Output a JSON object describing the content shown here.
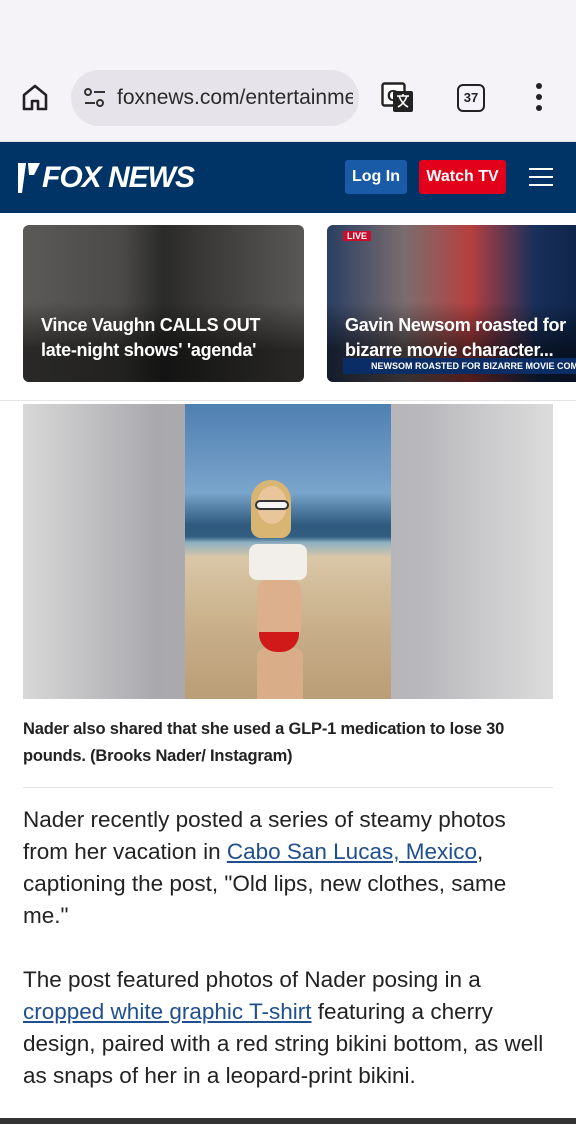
{
  "browser": {
    "url": "foxnews.com/entertainme",
    "tab_count": "37",
    "icons": [
      "home-icon",
      "site-settings-icon",
      "translate-icon",
      "tabs-icon",
      "more-vert-icon"
    ]
  },
  "header": {
    "logo_text": "FOX NEWS",
    "login_label": "Log In",
    "watch_label": "Watch TV",
    "brand_color": "#003366",
    "watch_color": "#e3001b",
    "login_color": "#1a5ba8"
  },
  "cards": [
    {
      "line1": "Vince Vaughn CALLS OUT",
      "line2": "late-night shows' 'agenda'"
    },
    {
      "line1": "Gavin Newsom roasted for",
      "line2": "bizarre movie character...",
      "live_tag": "LIVE",
      "chyron": "NEWSOM ROASTED FOR BIZARRE MOVIE COMPARISON"
    }
  ],
  "photo": {
    "caption": "Nader also shared that she used a GLP-1 medication to lose 30 pounds. (Brooks Nader/ Instagram)"
  },
  "article": {
    "p1_before": "Nader recently posted a series of steamy photos from her vacation in ",
    "p1_link": "Cabo San Lucas, Mexico",
    "p1_after": ", captioning the post, \"Old lips, new clothes, same me.\"",
    "p2_before": "The post featured photos of Nader posing in a ",
    "p2_link": "cropped white graphic T-shirt",
    "p2_after": " featuring a cherry design, paired with a red string bikini bottom, as well as snaps of her in a leopard-print bikini."
  }
}
